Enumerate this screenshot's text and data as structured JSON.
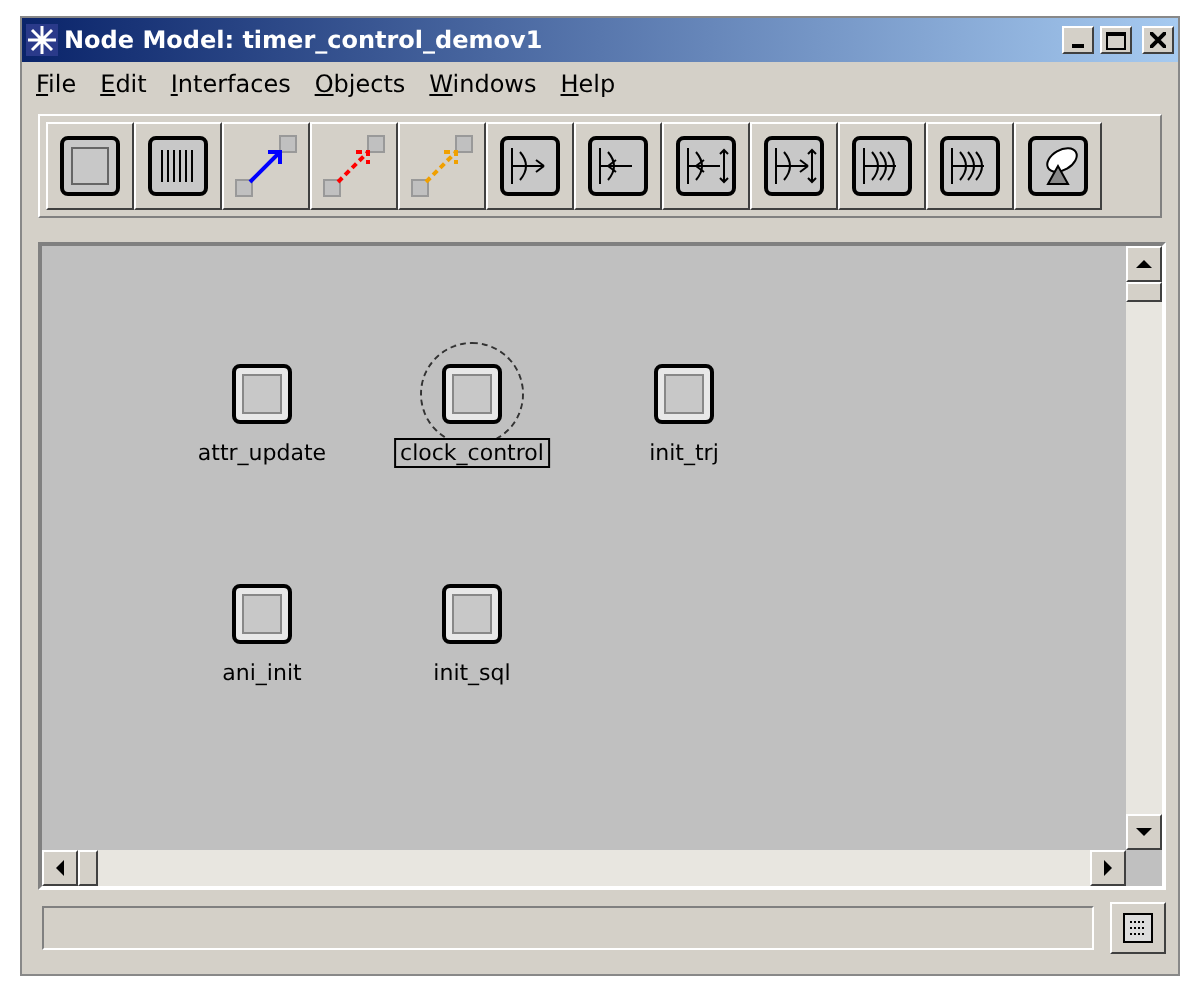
{
  "window": {
    "title": "Node Model: timer_control_demov1"
  },
  "menu": [
    {
      "label": "File"
    },
    {
      "label": "Edit"
    },
    {
      "label": "Interfaces"
    },
    {
      "label": "Objects"
    },
    {
      "label": "Windows"
    },
    {
      "label": "Help"
    }
  ],
  "toolbar": [
    {
      "kind": "processor"
    },
    {
      "kind": "queue"
    },
    {
      "kind": "packet_stream"
    },
    {
      "kind": "statistic_wire"
    },
    {
      "kind": "logical_tx"
    },
    {
      "kind": "transmitter"
    },
    {
      "kind": "receiver"
    },
    {
      "kind": "transceiver_rx"
    },
    {
      "kind": "transceiver_tx"
    },
    {
      "kind": "radio_rx"
    },
    {
      "kind": "radio_tx"
    },
    {
      "kind": "antenna"
    }
  ],
  "nodes": [
    {
      "label": "attr_update",
      "selected": false
    },
    {
      "label": "clock_control",
      "selected": true
    },
    {
      "label": "init_trj",
      "selected": false
    },
    {
      "label": "ani_init",
      "selected": false
    },
    {
      "label": "init_sql",
      "selected": false
    }
  ]
}
